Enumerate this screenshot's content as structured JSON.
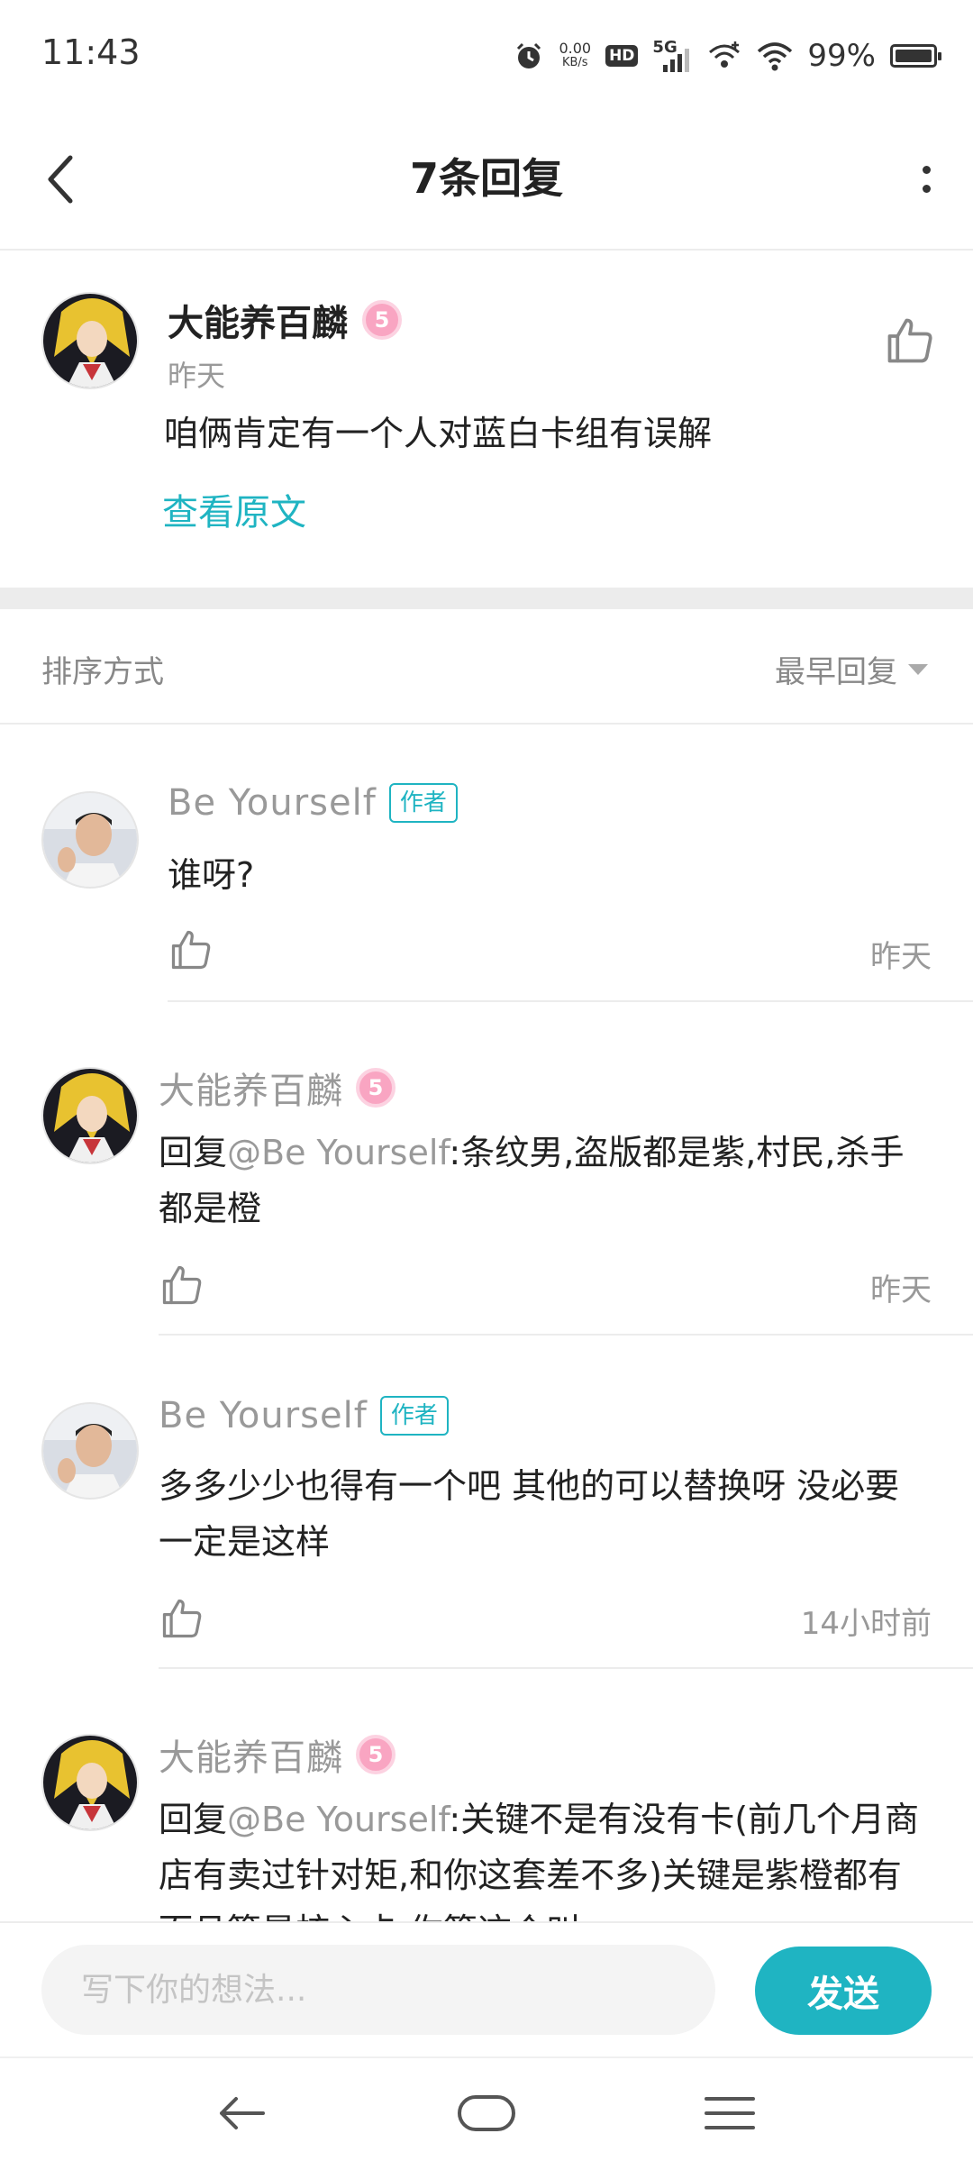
{
  "status_bar": {
    "time": "11:43",
    "net_speed": "0.00",
    "net_unit": "KB/s",
    "hd": "HD",
    "network_type": "5G",
    "battery_percent": "99%",
    "battery_level": 0.99
  },
  "header": {
    "title": "7条回复"
  },
  "post": {
    "author": "大能养百麟",
    "level": "5",
    "time": "昨天",
    "content": "咱俩肯定有一个人对蓝白卡组有误解",
    "view_original": "查看原文"
  },
  "sort": {
    "label": "排序方式",
    "selected": "最早回复"
  },
  "replies": [
    {
      "author": "Be  Yourself",
      "tag": "作者",
      "text": "谁呀?",
      "time": "昨天"
    },
    {
      "author": "大能养百麟",
      "level": "5",
      "prefix": "回复",
      "mention": "@Be  Yourself",
      "text": ":条纹男,盗版都是紫,村民,杀手都是橙",
      "time": "昨天"
    },
    {
      "author": "Be  Yourself",
      "tag": "作者",
      "text": "多多少少也得有一个吧 其他的可以替换呀 没必要一定是这样",
      "time": "14小时前"
    },
    {
      "author": "大能养百麟",
      "level": "5",
      "prefix": "回复",
      "mention": "@Be  Yourself",
      "text": ":关键不是有没有卡(前几个月商店有卖过针对矩,和你这套差不多)关键是紫橙都有而且算是核心卡,你算这个叫"
    }
  ],
  "input": {
    "placeholder": "写下你的想法...",
    "send_label": "发送"
  },
  "colors": {
    "accent": "#1fb4c2",
    "level_badge": "#f9a5c2"
  }
}
